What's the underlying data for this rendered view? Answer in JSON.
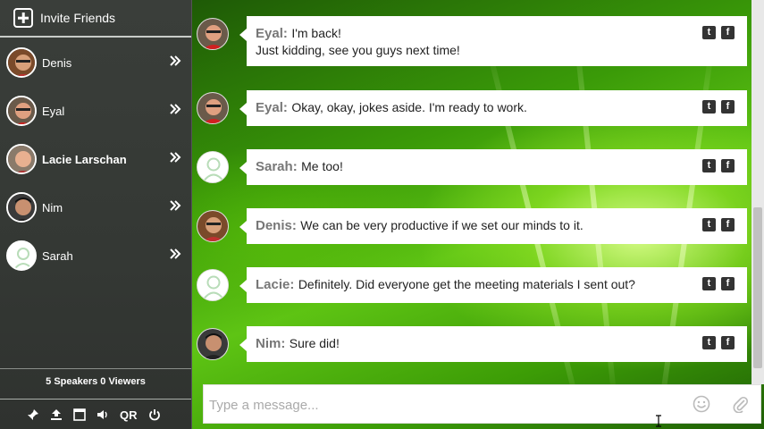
{
  "sidebar": {
    "invite_label": "Invite Friends",
    "users": [
      {
        "name": "Denis",
        "bold": false,
        "avatar": "photo"
      },
      {
        "name": "Eyal",
        "bold": false,
        "avatar": "photo"
      },
      {
        "name": "Lacie Larschan",
        "bold": true,
        "avatar": "photo"
      },
      {
        "name": "Nim",
        "bold": false,
        "avatar": "photo"
      },
      {
        "name": "Sarah",
        "bold": false,
        "avatar": "placeholder"
      }
    ],
    "counts": "5 Speakers 0 Viewers",
    "toolbar": {
      "qr_label": "QR",
      "icons": [
        "pin-icon",
        "upload-icon",
        "window-icon",
        "speaker-icon",
        "qr-button",
        "power-icon"
      ]
    }
  },
  "messages": [
    {
      "author": "Eyal:",
      "lines": [
        "I'm back!",
        "Just kidding, see you guys next time!"
      ],
      "avatar": "photo"
    },
    {
      "author": "Eyal:",
      "lines": [
        "Okay, okay, jokes aside. I'm ready to work."
      ],
      "avatar": "photo"
    },
    {
      "author": "Sarah:",
      "lines": [
        "Me too!"
      ],
      "avatar": "placeholder"
    },
    {
      "author": "Denis:",
      "lines": [
        "We can be very productive if we set our minds to it."
      ],
      "avatar": "photo"
    },
    {
      "author": "Lacie:",
      "lines": [
        "Definitely. Did everyone get the meeting materials I sent out?"
      ],
      "avatar": "placeholder"
    },
    {
      "author": "Nim:",
      "lines": [
        "Sure did!"
      ],
      "avatar": "photo"
    }
  ],
  "social": {
    "twitter": "t",
    "facebook": "f"
  },
  "composer": {
    "placeholder": "Type a message..."
  },
  "colors": {
    "sidebar_bg": "#363a36",
    "accent_green": "#5ec414",
    "bubble_bg": "#ffffff",
    "author_grey": "#777777"
  }
}
